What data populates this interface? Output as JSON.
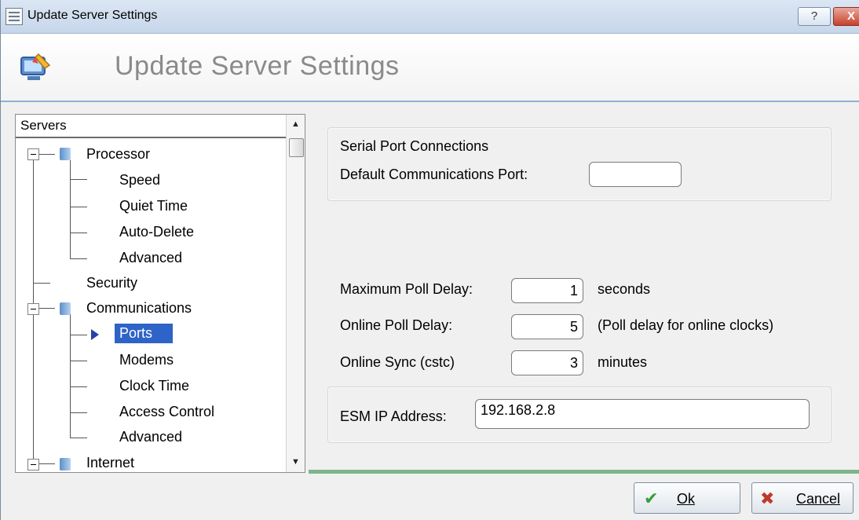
{
  "window": {
    "title": "Update Server Settings",
    "help_button": "?",
    "close_button": "X"
  },
  "header": {
    "title": "Update Server Settings"
  },
  "tree": {
    "header": "Servers",
    "items": [
      {
        "label": "Processor"
      },
      {
        "label": "Speed"
      },
      {
        "label": "Quiet Time"
      },
      {
        "label": "Auto-Delete"
      },
      {
        "label": "Advanced"
      },
      {
        "label": "Security"
      },
      {
        "label": "Communications"
      },
      {
        "label": "Ports"
      },
      {
        "label": "Modems"
      },
      {
        "label": "Clock Time"
      },
      {
        "label": "Access Control"
      },
      {
        "label": "Advanced"
      },
      {
        "label": "Internet"
      }
    ],
    "selected": "Ports"
  },
  "settings": {
    "serial_group_title": "Serial Port Connections",
    "default_port_label": "Default Communications Port:",
    "default_port_value": "",
    "max_poll_label": "Maximum Poll Delay:",
    "max_poll_value": "1",
    "max_poll_unit": "seconds",
    "online_poll_label": "Online Poll Delay:",
    "online_poll_value": "5",
    "online_poll_unit": "(Poll delay for online clocks)",
    "online_sync_label": "Online Sync (cstc)",
    "online_sync_value": "3",
    "online_sync_unit": "minutes",
    "esm_label": "ESM IP Address:",
    "esm_value": "192.168.2.8"
  },
  "buttons": {
    "ok": "Ok",
    "cancel": "Cancel"
  },
  "colors": {
    "selection": "#2e63c7",
    "accent_line": "#7fb48c",
    "header_border": "#8fb0d6"
  }
}
